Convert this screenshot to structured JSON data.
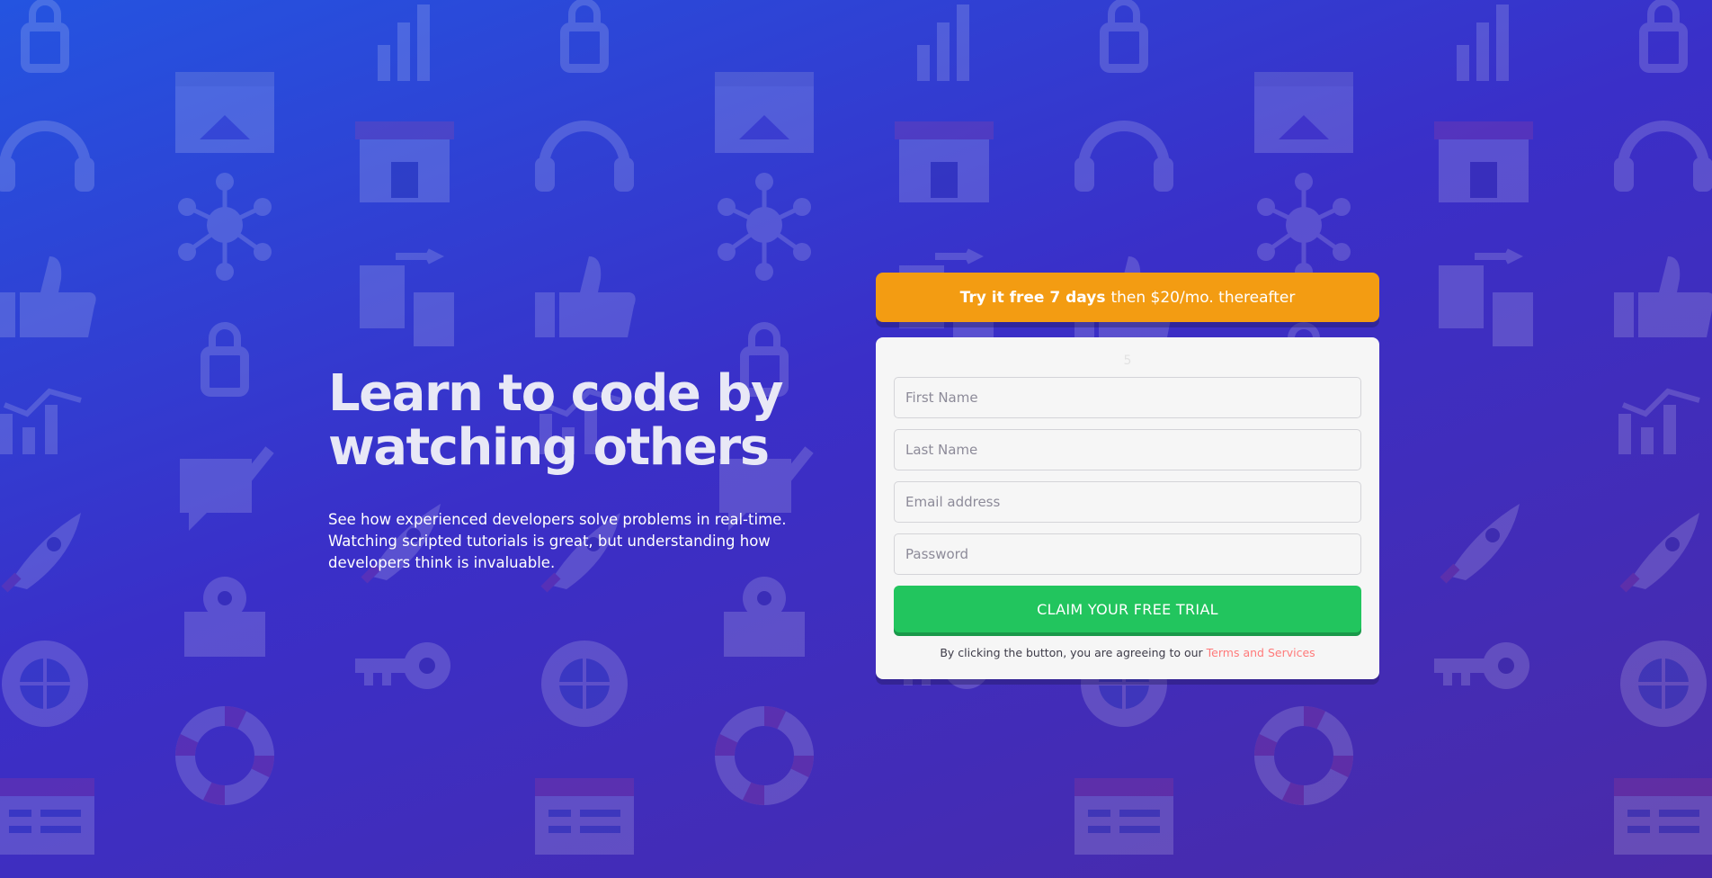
{
  "hero": {
    "title": "Learn to code by watching others",
    "description": "See how experienced developers solve problems in real-time. Watching scripted tutorials is great, but understanding how developers think is invaluable."
  },
  "offer": {
    "bold_text": "Try it free 7 days",
    "rest_text": "then $20/mo. thereafter"
  },
  "form": {
    "stray_mark": "5",
    "first_name_placeholder": "First Name",
    "last_name_placeholder": "Last Name",
    "email_placeholder": "Email address",
    "password_placeholder": "Password",
    "submit_label": "CLAIM YOUR FREE TRIAL",
    "terms_text": "By clicking the button, you are agreeing to our",
    "terms_link": "Terms and Services"
  },
  "colors": {
    "background_start": "#2454e0",
    "background_end": "#4a2aa8",
    "offer": "#f39c12",
    "submit": "#22c55e",
    "terms_link": "#ff7a7a"
  },
  "background_icons": [
    "padlock-icon",
    "bar-chart-icon",
    "browser-home-icon",
    "headset-icon",
    "shop-icon",
    "network-icon",
    "thumbs-up-icon",
    "file-transfer-icon",
    "chart-line-icon",
    "message-edit-icon",
    "rocket-icon",
    "gear-box-icon",
    "key-icon",
    "globe-gear-icon",
    "lifebuoy-icon",
    "calendar-icon"
  ]
}
